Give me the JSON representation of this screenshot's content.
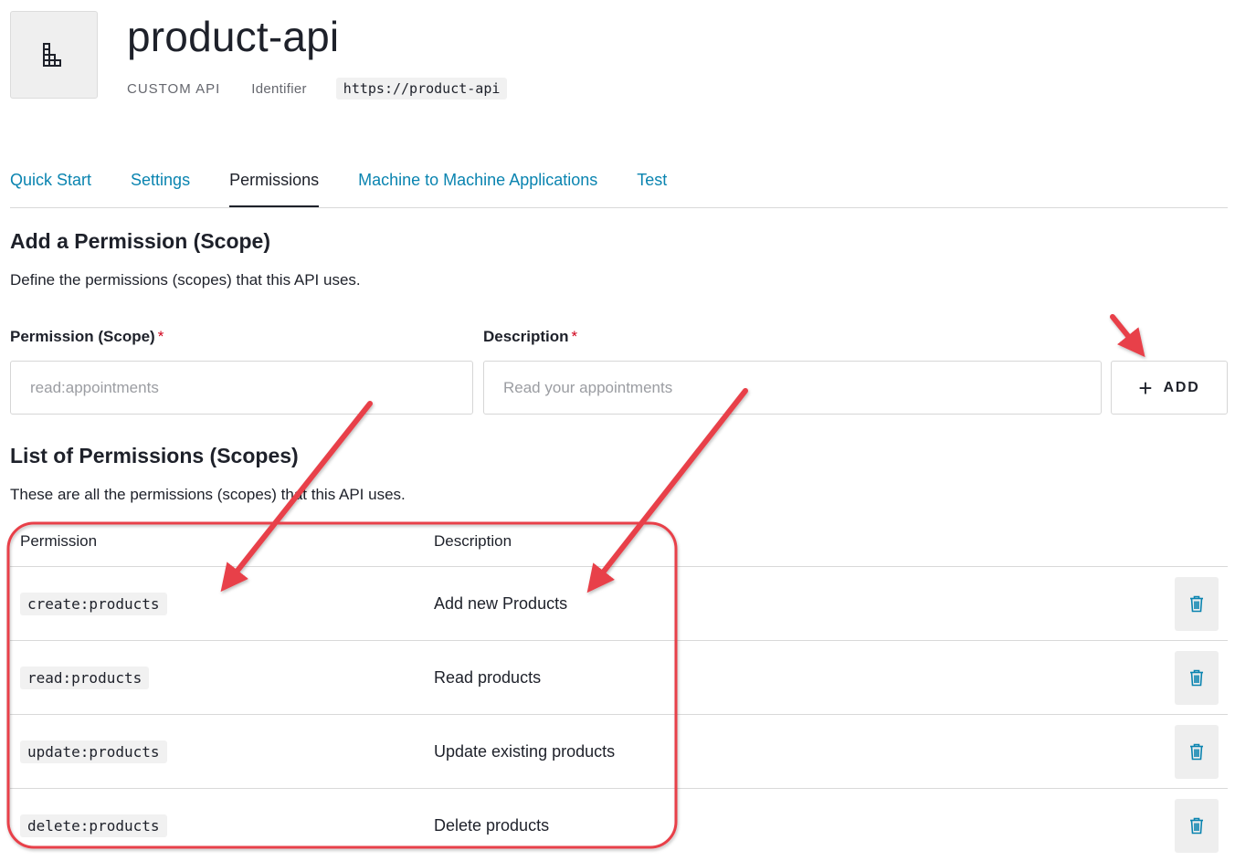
{
  "api": {
    "title": "product-api",
    "type": "CUSTOM API",
    "identifier_label": "Identifier",
    "identifier_value": "https://product-api"
  },
  "tabs": [
    {
      "label": "Quick Start"
    },
    {
      "label": "Settings"
    },
    {
      "label": "Permissions"
    },
    {
      "label": "Machine to Machine Applications"
    },
    {
      "label": "Test"
    }
  ],
  "active_tab": "Permissions",
  "add_section": {
    "title": "Add a Permission (Scope)",
    "description": "Define the permissions (scopes) that this API uses.",
    "scope_label": "Permission (Scope)",
    "scope_placeholder": "read:appointments",
    "desc_label": "Description",
    "desc_placeholder": "Read your appointments",
    "required_mark": "*",
    "add_label": "ADD"
  },
  "list_section": {
    "title": "List of Permissions (Scopes)",
    "description": "These are all the permissions (scopes) that this API uses.",
    "col_permission": "Permission",
    "col_description": "Description",
    "rows": [
      {
        "scope": "create:products",
        "description": "Add new Products"
      },
      {
        "scope": "read:products",
        "description": "Read products"
      },
      {
        "scope": "update:products",
        "description": "Update existing products"
      },
      {
        "scope": "delete:products",
        "description": "Delete products"
      }
    ]
  },
  "colors": {
    "link": "#0a84b0",
    "required": "#d0021b",
    "annotation": "#e8414a",
    "trash": "#0a84b0"
  },
  "icons": {
    "api_logo": "building-blocks-icon",
    "add": "plus-icon",
    "delete": "trash-icon"
  }
}
